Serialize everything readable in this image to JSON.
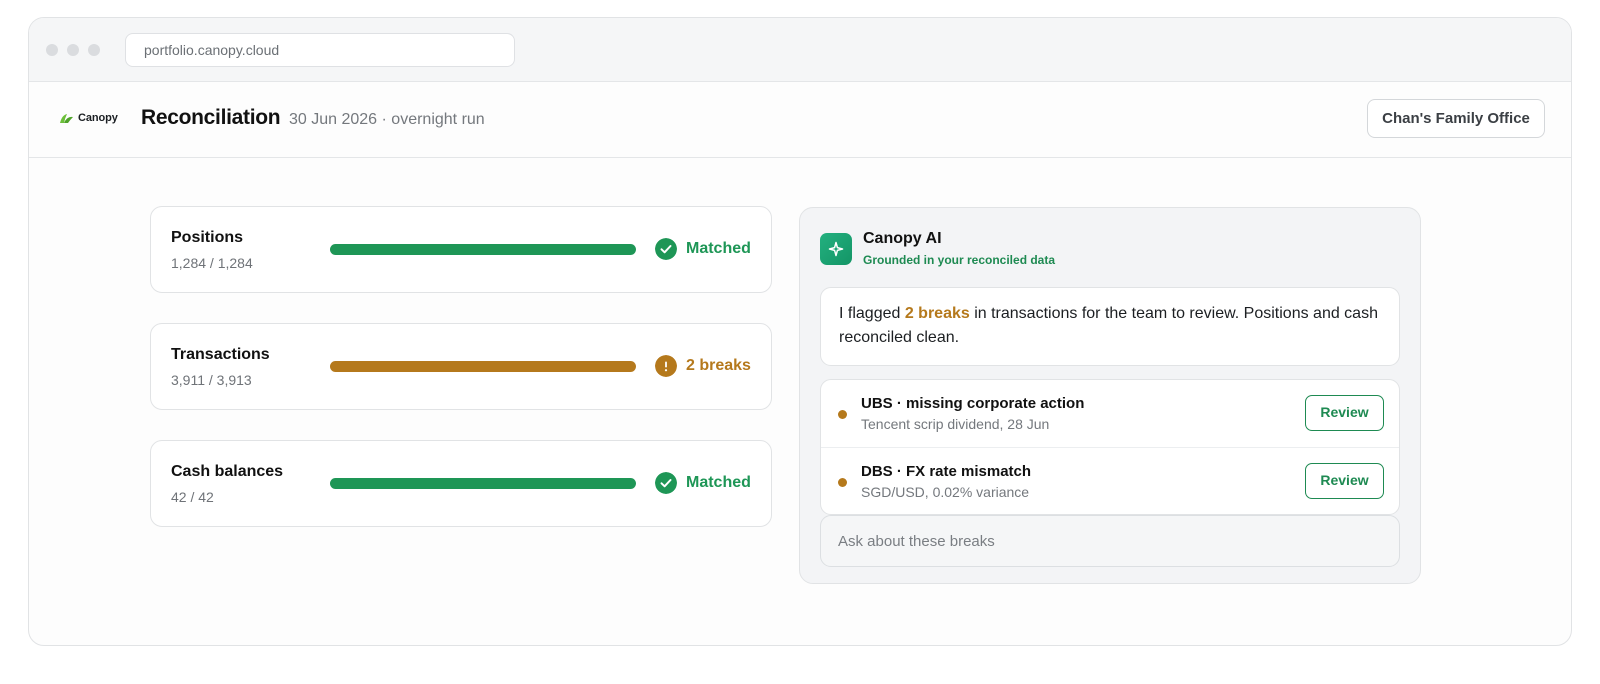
{
  "browser": {
    "url": "portfolio.canopy.cloud"
  },
  "brand": {
    "name": "Canopy",
    "accent": "#6cbf3a"
  },
  "header": {
    "title": "Reconciliation",
    "subtitle": "30 Jun 2026 · overnight run",
    "office_button": "Chan's Family Office"
  },
  "colors": {
    "matched": "#1e9656",
    "break": "#b5791c"
  },
  "reconciliations": [
    {
      "name": "Positions",
      "count": "1,284 / 1,284",
      "status": "Matched",
      "state": "matched",
      "progress_pct": 100,
      "icon": "check-circle-icon"
    },
    {
      "name": "Transactions",
      "count": "3,911 / 3,913",
      "status": "2 breaks",
      "state": "break",
      "progress_pct": 100,
      "icon": "alert-circle-icon"
    },
    {
      "name": "Cash balances",
      "count": "42 / 42",
      "status": "Matched",
      "state": "matched",
      "progress_pct": 100,
      "icon": "check-circle-icon"
    }
  ],
  "ai": {
    "icon": "sparkle-icon",
    "title": "Canopy AI",
    "subtitle": "Grounded in your reconciled data",
    "message_pre": "I flagged ",
    "message_highlight": "2 breaks",
    "message_post": " in transactions for the team to review. Positions and cash reconciled clean.",
    "breaks": [
      {
        "title": "UBS · missing corporate action",
        "detail": "Tencent scrip dividend, 28 Jun",
        "action": "Review"
      },
      {
        "title": "DBS · FX rate mismatch",
        "detail": "SGD/USD, 0.02% variance",
        "action": "Review"
      }
    ],
    "ask_placeholder": "Ask about these breaks"
  }
}
